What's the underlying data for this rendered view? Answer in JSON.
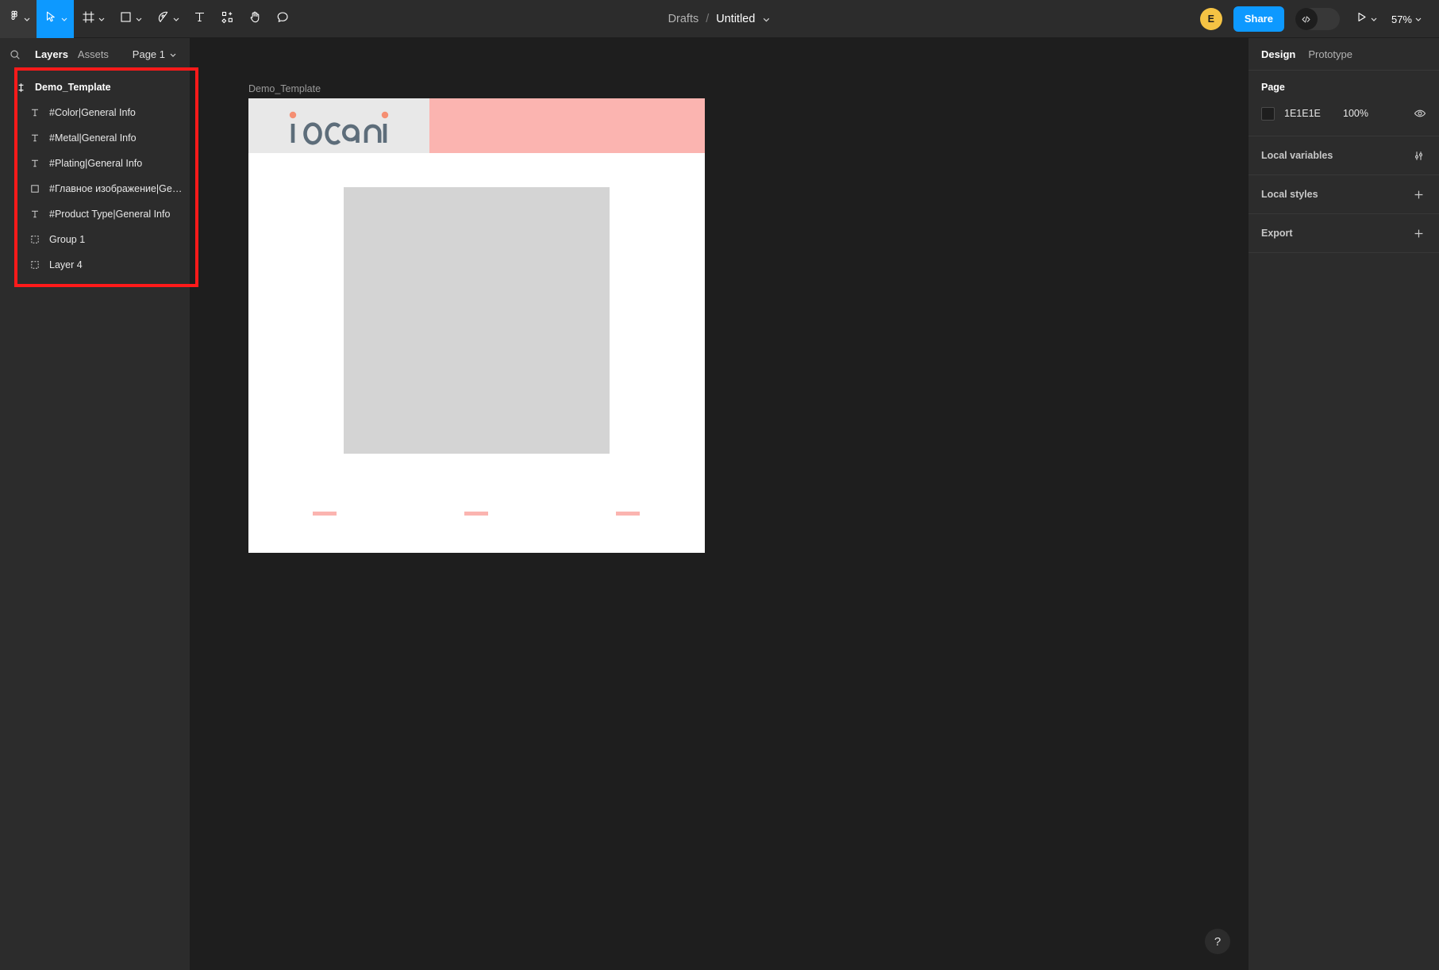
{
  "toolbar": {
    "menu_icon": "figma-logo-icon",
    "tools": [
      {
        "name": "move-tool",
        "icon": "cursor-icon",
        "caret": true,
        "active": true
      },
      {
        "name": "frame-tool",
        "icon": "frame-icon",
        "caret": true,
        "active": false
      },
      {
        "name": "shape-tool",
        "icon": "rectangle-icon",
        "caret": true,
        "active": false
      },
      {
        "name": "pen-tool",
        "icon": "pen-icon",
        "caret": true,
        "active": false
      },
      {
        "name": "text-tool",
        "icon": "text-icon",
        "caret": false,
        "active": false
      },
      {
        "name": "resources-tool",
        "icon": "components-icon",
        "caret": false,
        "active": false
      },
      {
        "name": "hand-tool",
        "icon": "hand-icon",
        "caret": false,
        "active": false
      },
      {
        "name": "comment-tool",
        "icon": "comment-icon",
        "caret": false,
        "active": false
      }
    ],
    "breadcrumb_project": "Drafts",
    "breadcrumb_separator": "/",
    "breadcrumb_file": "Untitled",
    "avatar_initial": "E",
    "share_label": "Share",
    "devmode_icon": "code-icon",
    "present_icon": "play-icon",
    "zoom_level": "57%"
  },
  "left_panel": {
    "search_icon": "search-icon",
    "tab_layers": "Layers",
    "tab_assets": "Assets",
    "page_selector": "Page 1",
    "highlight_color": "#FF1A1A",
    "layers": [
      {
        "name": "Demo_Template",
        "icon": "section-icon",
        "indent": 0,
        "type": "section"
      },
      {
        "name": "#Color|General Info",
        "icon": "text-icon",
        "indent": 1,
        "type": "text"
      },
      {
        "name": "#Metal|General Info",
        "icon": "text-icon",
        "indent": 1,
        "type": "text"
      },
      {
        "name": "#Plating|General Info",
        "icon": "text-icon",
        "indent": 1,
        "type": "text"
      },
      {
        "name": "#Главное изображение|Gen...",
        "icon": "rectangle-icon",
        "indent": 1,
        "type": "rectangle"
      },
      {
        "name": "#Product Type|General Info",
        "icon": "text-icon",
        "indent": 1,
        "type": "text"
      },
      {
        "name": "Group 1",
        "icon": "group-icon",
        "indent": 1,
        "type": "group"
      },
      {
        "name": "Layer 4",
        "icon": "group-icon",
        "indent": 1,
        "type": "group"
      }
    ]
  },
  "canvas": {
    "frame_label": "Demo_Template",
    "background_color": "#1E1E1E",
    "artboard": {
      "background_color": "#FFFFFF",
      "logo_band_color": "#E8E8E8",
      "pink_band_color": "#FBB4B0",
      "logo_text": "iocani",
      "logo_text_color": "#5D6D7A",
      "logo_dot_color": "#F58F73",
      "image_placeholder_color": "#D4D4D4",
      "accent_bar_color": "#FBB4B0",
      "accent_bar_count": 3
    }
  },
  "right_panel": {
    "tab_design": "Design",
    "tab_prototype": "Prototype",
    "page_section_title": "Page",
    "page_color_hex": "1E1E1E",
    "page_color_swatch": "#1E1E1E",
    "page_opacity": "100%",
    "visibility_icon": "eye-icon",
    "rows": [
      {
        "label": "Local variables",
        "action_icon": "sliders-icon"
      },
      {
        "label": "Local styles",
        "action_icon": "plus-icon"
      },
      {
        "label": "Export",
        "action_icon": "plus-icon"
      }
    ]
  },
  "help": {
    "label": "?"
  }
}
